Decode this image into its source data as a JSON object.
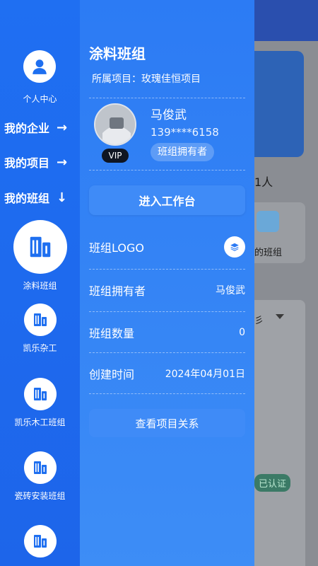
{
  "background": {
    "member_count": "1人",
    "card_label": "的班组",
    "dropdown_text": "彡",
    "verified_badge": "已认证"
  },
  "sidebar": {
    "profile_label": "个人中心",
    "nav": [
      {
        "label": "我的企业",
        "arrow": "→"
      },
      {
        "label": "我的项目",
        "arrow": "→"
      },
      {
        "label": "我的班组",
        "arrow": "↓"
      }
    ],
    "teams": [
      {
        "name": "涂料班组"
      },
      {
        "name": "凯乐杂工"
      },
      {
        "name": "凯乐木工班组"
      },
      {
        "name": "瓷砖安装班组"
      },
      {
        "name": ""
      }
    ]
  },
  "drawer": {
    "title": "涂料班组",
    "project_line": "所属项目：玫瑰佳恒项目",
    "user": {
      "name": "马俊武",
      "phone": "139****6158",
      "role": "班组拥有者",
      "vip": "VIP"
    },
    "enter_button": "进入工作台",
    "rows": [
      {
        "label": "班组LOGO",
        "value": ""
      },
      {
        "label": "班组拥有者",
        "value": "马俊武"
      },
      {
        "label": "班组数量",
        "value": "0"
      },
      {
        "label": "创建时间",
        "value": "2024年04月01日"
      }
    ],
    "relation_button": "查看项目关系"
  },
  "colors": {
    "sidebar": "#1f6ff2",
    "drawer": "#2c7bf4",
    "button": "#3f8bf7",
    "accent_icon": "#1e6ff0"
  }
}
